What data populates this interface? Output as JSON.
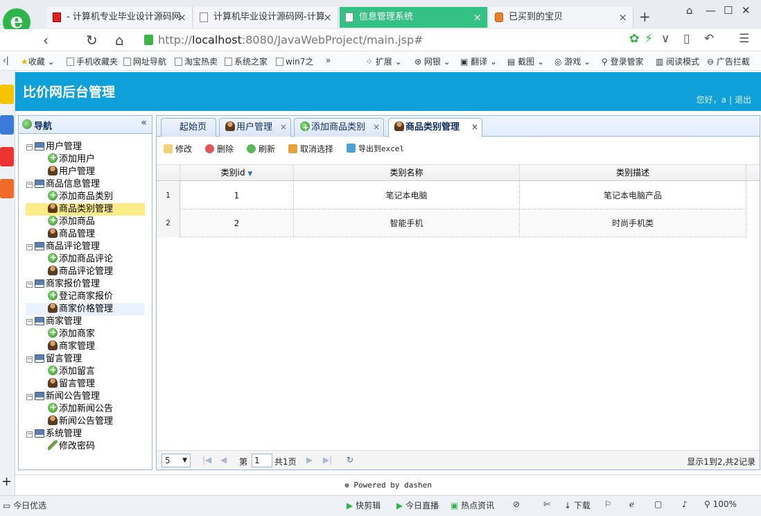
{
  "browser": {
    "tabs": [
      {
        "label": "- 计算机专业毕业设计源码网",
        "active": false
      },
      {
        "label": "计算机毕业设计源码网-计算",
        "active": false
      },
      {
        "label": "信息管理系统",
        "active": true
      },
      {
        "label": "已买到的宝贝",
        "active": false
      }
    ],
    "url_scheme": "http://",
    "url_host": "localhost",
    "url_rest": ":8080/JavaWebProject/main.jsp#",
    "favorites": [
      "收藏",
      "手机收藏夹",
      "网址导航",
      "淘宝热卖",
      "系统之家",
      "win7之",
      "扩展",
      "网银",
      "翻译",
      "截图",
      "游戏",
      "登录管家",
      "阅读模式",
      "广告拦截"
    ],
    "status_left": "今日优选",
    "status_items": [
      "快剪辑",
      "今日直播",
      "热点资讯",
      "下载",
      "100%"
    ]
  },
  "app": {
    "title": "比价网后台管理",
    "greeting": "您好，a",
    "logout": "退出",
    "footer": "Powered by dashen"
  },
  "nav": {
    "title": "导航",
    "groups": [
      {
        "label": "用户管理",
        "items": [
          "添加用户",
          "用户管理"
        ]
      },
      {
        "label": "商品信息管理",
        "items": [
          "添加商品类别",
          "商品类别管理",
          "添加商品",
          "商品管理"
        ]
      },
      {
        "label": "商品评论管理",
        "items": [
          "添加商品评论",
          "商品评论管理"
        ]
      },
      {
        "label": "商家报价管理",
        "items": [
          "登记商家报价",
          "商家价格管理"
        ]
      },
      {
        "label": "商家管理",
        "items": [
          "添加商家",
          "商家管理"
        ]
      },
      {
        "label": "留言管理",
        "items": [
          "添加留言",
          "留言管理"
        ]
      },
      {
        "label": "新闻公告管理",
        "items": [
          "添加新闻公告",
          "新闻公告管理"
        ]
      },
      {
        "label": "系统管理",
        "items": [
          "修改密码"
        ]
      }
    ]
  },
  "tabs": [
    {
      "label": "起始页",
      "closable": false
    },
    {
      "label": "用户管理",
      "closable": true
    },
    {
      "label": "添加商品类别",
      "closable": true
    },
    {
      "label": "商品类别管理",
      "closable": true,
      "active": true
    }
  ],
  "toolbar": {
    "edit": "修改",
    "delete": "删除",
    "refresh": "刷新",
    "unselect": "取消选择",
    "export": "导出到excel"
  },
  "grid": {
    "columns": [
      "类别id",
      "类别名称",
      "类别描述"
    ],
    "rows": [
      {
        "num": "1",
        "id": "1",
        "name": "笔记本电脑",
        "desc": "笔记本电脑产品"
      },
      {
        "num": "2",
        "id": "2",
        "name": "智能手机",
        "desc": "时尚手机类"
      }
    ]
  },
  "pager": {
    "page_size": "5",
    "page_label": "第",
    "page_value": "1",
    "total_pages": "共1页",
    "summary": "显示1到2,共2记录"
  }
}
